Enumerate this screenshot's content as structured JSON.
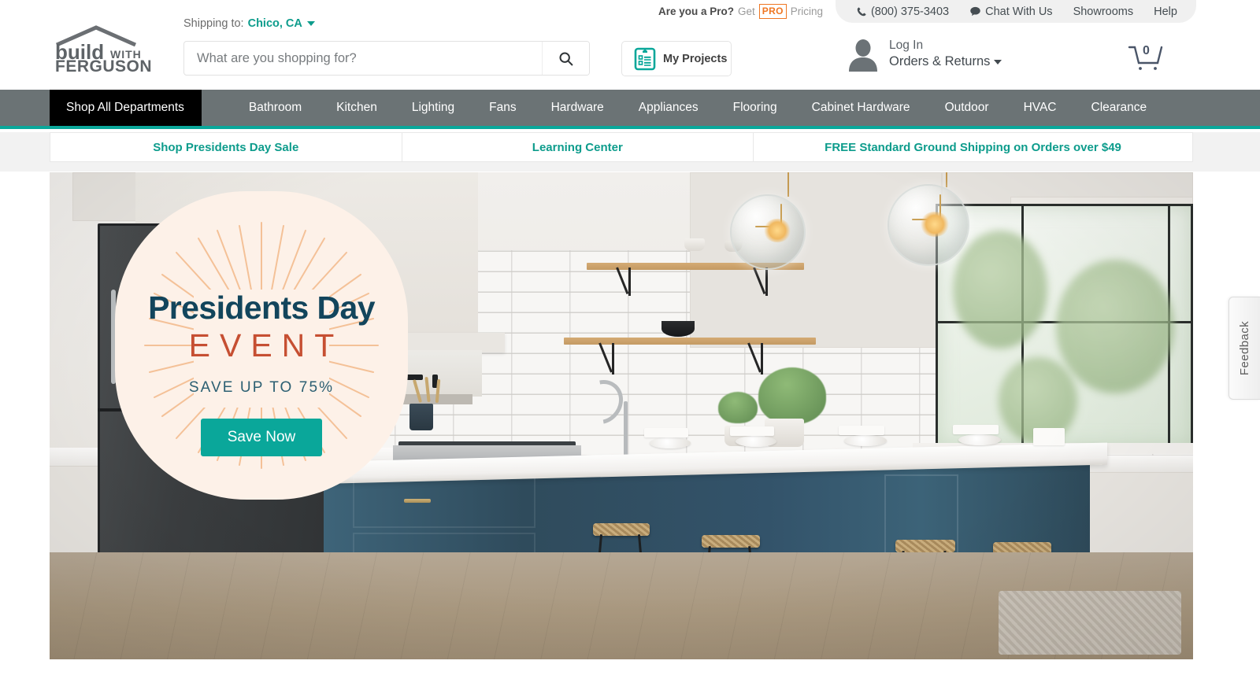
{
  "brand": {
    "logo_line1": "build",
    "logo_with": "WITH",
    "logo_line2": "FERGUSON",
    "accent_teal": "#0aa79a",
    "accent_teal_text": "#0d9c8c",
    "accent_orange": "#ef7622",
    "nav_gray": "#6b7375",
    "badge_navy": "#12455c",
    "badge_rust": "#c64f32",
    "badge_cream": "#fdf1e8"
  },
  "utility": {
    "pro_question": "Are you a Pro?",
    "pro_get": "Get",
    "pro_badge": "PRO",
    "pro_pricing": "Pricing",
    "phone": "(800) 375-3403",
    "chat": "Chat With Us",
    "showrooms": "Showrooms",
    "help": "Help"
  },
  "header": {
    "shipping_label": "Shipping to:",
    "shipping_city": "Chico, CA",
    "search_placeholder": "What are you shopping for?",
    "search_value": "",
    "my_projects": "My Projects",
    "account_login": "Log In",
    "account_orders": "Orders & Returns",
    "cart_count": "0"
  },
  "nav": {
    "shop_all": "Shop All Departments",
    "items": [
      {
        "label": "Bathroom"
      },
      {
        "label": "Kitchen"
      },
      {
        "label": "Lighting"
      },
      {
        "label": "Fans"
      },
      {
        "label": "Hardware"
      },
      {
        "label": "Appliances"
      },
      {
        "label": "Flooring"
      },
      {
        "label": "Cabinet Hardware"
      },
      {
        "label": "Outdoor"
      },
      {
        "label": "HVAC"
      },
      {
        "label": "Clearance"
      }
    ]
  },
  "promo": {
    "items": [
      {
        "label": "Shop Presidents Day Sale"
      },
      {
        "label": "Learning Center"
      },
      {
        "label": "FREE Standard Ground Shipping on Orders over $49"
      }
    ]
  },
  "hero": {
    "badge_title": "Presidents Day",
    "badge_subtitle": "EVENT",
    "badge_save": "SAVE UP TO 75%",
    "badge_button": "Save Now",
    "alt": "Modern white kitchen with blue island, wicker bar stools, glass globe pendant lights and black framed window"
  },
  "feedback": {
    "label": "Feedback"
  }
}
